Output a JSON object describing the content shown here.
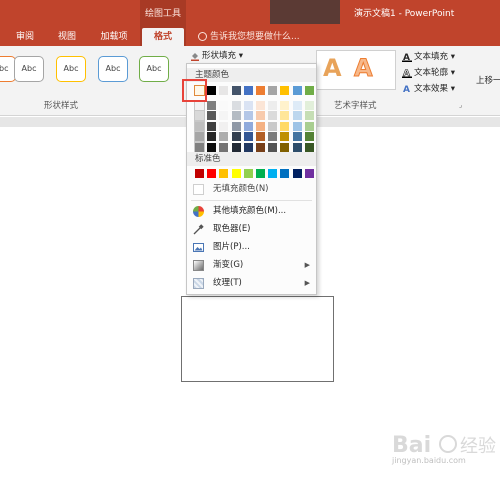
{
  "titlebar": {
    "context_group": "绘图工具",
    "document_title": "演示文稿1 - PowerPoint",
    "tabs": [
      "审阅",
      "视图",
      "加载项",
      "格式"
    ],
    "tell_me": "告诉我您想要做什么..."
  },
  "ribbon": {
    "shape_style_samples": [
      "Abc",
      "Abc",
      "Abc",
      "Abc",
      "Abc"
    ],
    "shape_fill_button": "形状填充",
    "shape_styles_group": "形状样式",
    "wordart_group": "艺术字样式",
    "text_fill": "文本填充",
    "text_outline": "文本轮廓",
    "text_effects": "文本效果",
    "arrange_cmd": "上移一"
  },
  "dropdown": {
    "theme_colors_label": "主题颜色",
    "standard_colors_label": "标准色",
    "no_fill": "无填充颜色(N)",
    "more_fill_colors": "其他填充颜色(M)...",
    "eyedropper": "取色器(E)",
    "picture": "图片(P)...",
    "gradient": "渐变(G)",
    "texture": "纹理(T)"
  },
  "colors": {
    "theme_top": [
      "#ffffff",
      "#000000",
      "#e7e6e6",
      "#44546a",
      "#4472c4",
      "#ed7d31",
      "#a5a5a5",
      "#ffc000",
      "#5b9bd5",
      "#70ad47"
    ],
    "standard": [
      "#c00000",
      "#ff0000",
      "#ffc000",
      "#ffff00",
      "#92d050",
      "#00b050",
      "#00b0f0",
      "#0070c0",
      "#002060",
      "#7030a0"
    ],
    "accent": "#c0442c"
  },
  "watermark": {
    "logo_text": "Bai 经验",
    "url": "jingyan.baidu.com"
  }
}
